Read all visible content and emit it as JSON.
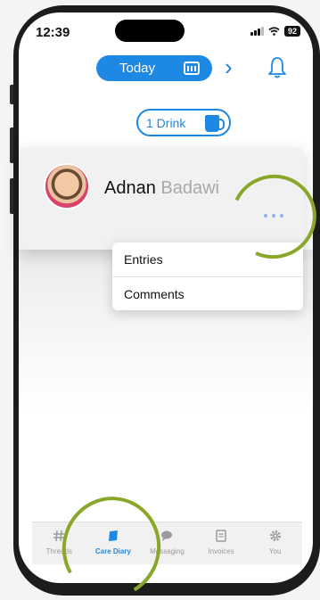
{
  "status_bar": {
    "time": "12:39",
    "battery": "92"
  },
  "header": {
    "date_label": "Today",
    "prev_icon": "chevron-left-icon",
    "next_icon": "chevron-right-icon",
    "calendar_icon": "calendar-icon",
    "bell_icon": "bell-icon"
  },
  "drink_badge": {
    "label": "1 Drink",
    "icon": "mug-icon"
  },
  "child": {
    "first_name": "Adnan",
    "last_name": "Badawi"
  },
  "menu": {
    "items": [
      "Entries",
      "Comments"
    ]
  },
  "tabs": [
    {
      "label": "Threads",
      "icon": "hash-icon",
      "active": false
    },
    {
      "label": "Care Diary",
      "icon": "book-icon",
      "active": true
    },
    {
      "label": "Messaging",
      "icon": "chat-bubble-icon",
      "active": false
    },
    {
      "label": "Invoices",
      "icon": "invoice-icon",
      "active": false
    },
    {
      "label": "You",
      "icon": "gear-icon",
      "active": false
    }
  ],
  "colors": {
    "accent": "#1e88e5",
    "highlight_ring": "#8aa72a",
    "muted_text": "#a9a9ad"
  }
}
